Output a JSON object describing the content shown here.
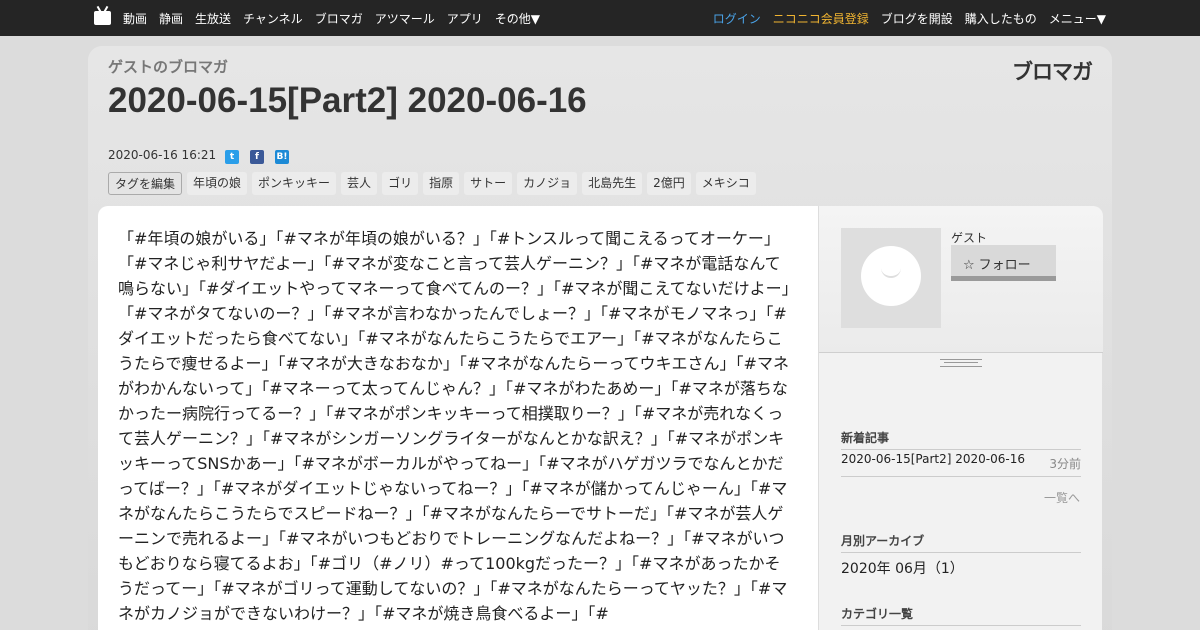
{
  "nav": {
    "left_items": [
      "動画",
      "静画",
      "生放送",
      "チャンネル",
      "ブロマガ",
      "アツマール",
      "アプリ",
      "その他▼"
    ],
    "login": "ログイン",
    "register": "ニコニコ会員登録",
    "open_blog": "ブログを開設",
    "purchased": "購入したもの",
    "menu": "メニュー▼"
  },
  "header": {
    "owner": "ゲストのブロマガ",
    "brand": "ブロマガ",
    "title": "2020-06-15[Part2] 2020-06-16",
    "date": "2020-06-16 16:21",
    "share": {
      "twitter": "t",
      "facebook": "f",
      "hatena": "B!"
    }
  },
  "tags": {
    "edit_label": "タグを編集",
    "items": [
      "年頃の娘",
      "ポンキッキー",
      "芸人",
      "ゴリ",
      "指原",
      "サトー",
      "カノジョ",
      "北島先生",
      "2億円",
      "メキシコ"
    ]
  },
  "article": {
    "body": "「#年頃の娘がいる」「#マネが年頃の娘がいる？」「#トンスルって聞こえるってオーケー」「#マネじゃ利サヤだよー」「#マネが変なこと言って芸人ゲーニン？」「#マネが電話なんて鳴らない」「#ダイエットやってマネーって食べてんのー？」「#マネが聞こえてないだけよー」「#マネがタてないのー？」「#マネが言わなかったんでしょー？」「#マネがモノマネっ」「#ダイエットだったら食べてない」「#マネがなんたらこうたらでエアー」「#マネがなんたらこうたらで痩せるよー」「#マネが大きなおなか」「#マネがなんたらーってウキエさん」「#マネがわかんないって」「#マネーって太ってんじゃん？」「#マネがわたあめー」「#マネが落ちなかったー病院行ってるー？」「#マネがポンキッキーって相撲取りー？」「#マネが売れなくって芸人ゲーニン？」「#マネがシンガーソングライターがなんとかな訳え？」「#マネがポンキッキーってSNSかあー」「#マネがボーカルがやってねー」「#マネがハゲガツラでなんとかだってばー？」「#マネがダイエットじゃないってねー？」「#マネが儲かってんじゃーん」「#マネがなんたらこうたらでスピードねー？」「#マネがなんたらーでサトーだ」「#マネが芸人ゲーニンで売れるよー」「#マネがいつもどおりでトレーニングなんだよねー？」「#マネがいつもどおりなら寝てるよお」「#ゴリ（#ノリ）#って100kgだったー？」「#マネがあったかそうだってー」「#マネがゴリって運動してないの？」「#マネがなんたらーってヤッた？」「#マネがカノジョができないわけー？」「#マネが焼き鳥食べるよー」「#"
  },
  "sidebar": {
    "guest_name": "ゲスト",
    "follow_label": "フォロー",
    "recent_title": "新着記事",
    "recent_item": "2020-06-15[Part2] 2020-06-16",
    "recent_ago": "3分前",
    "more_label": "一覧へ",
    "archive_title": "月別アーカイブ",
    "archive_item": "2020年 06月（1）",
    "category_title": "カテゴリ一覧"
  }
}
